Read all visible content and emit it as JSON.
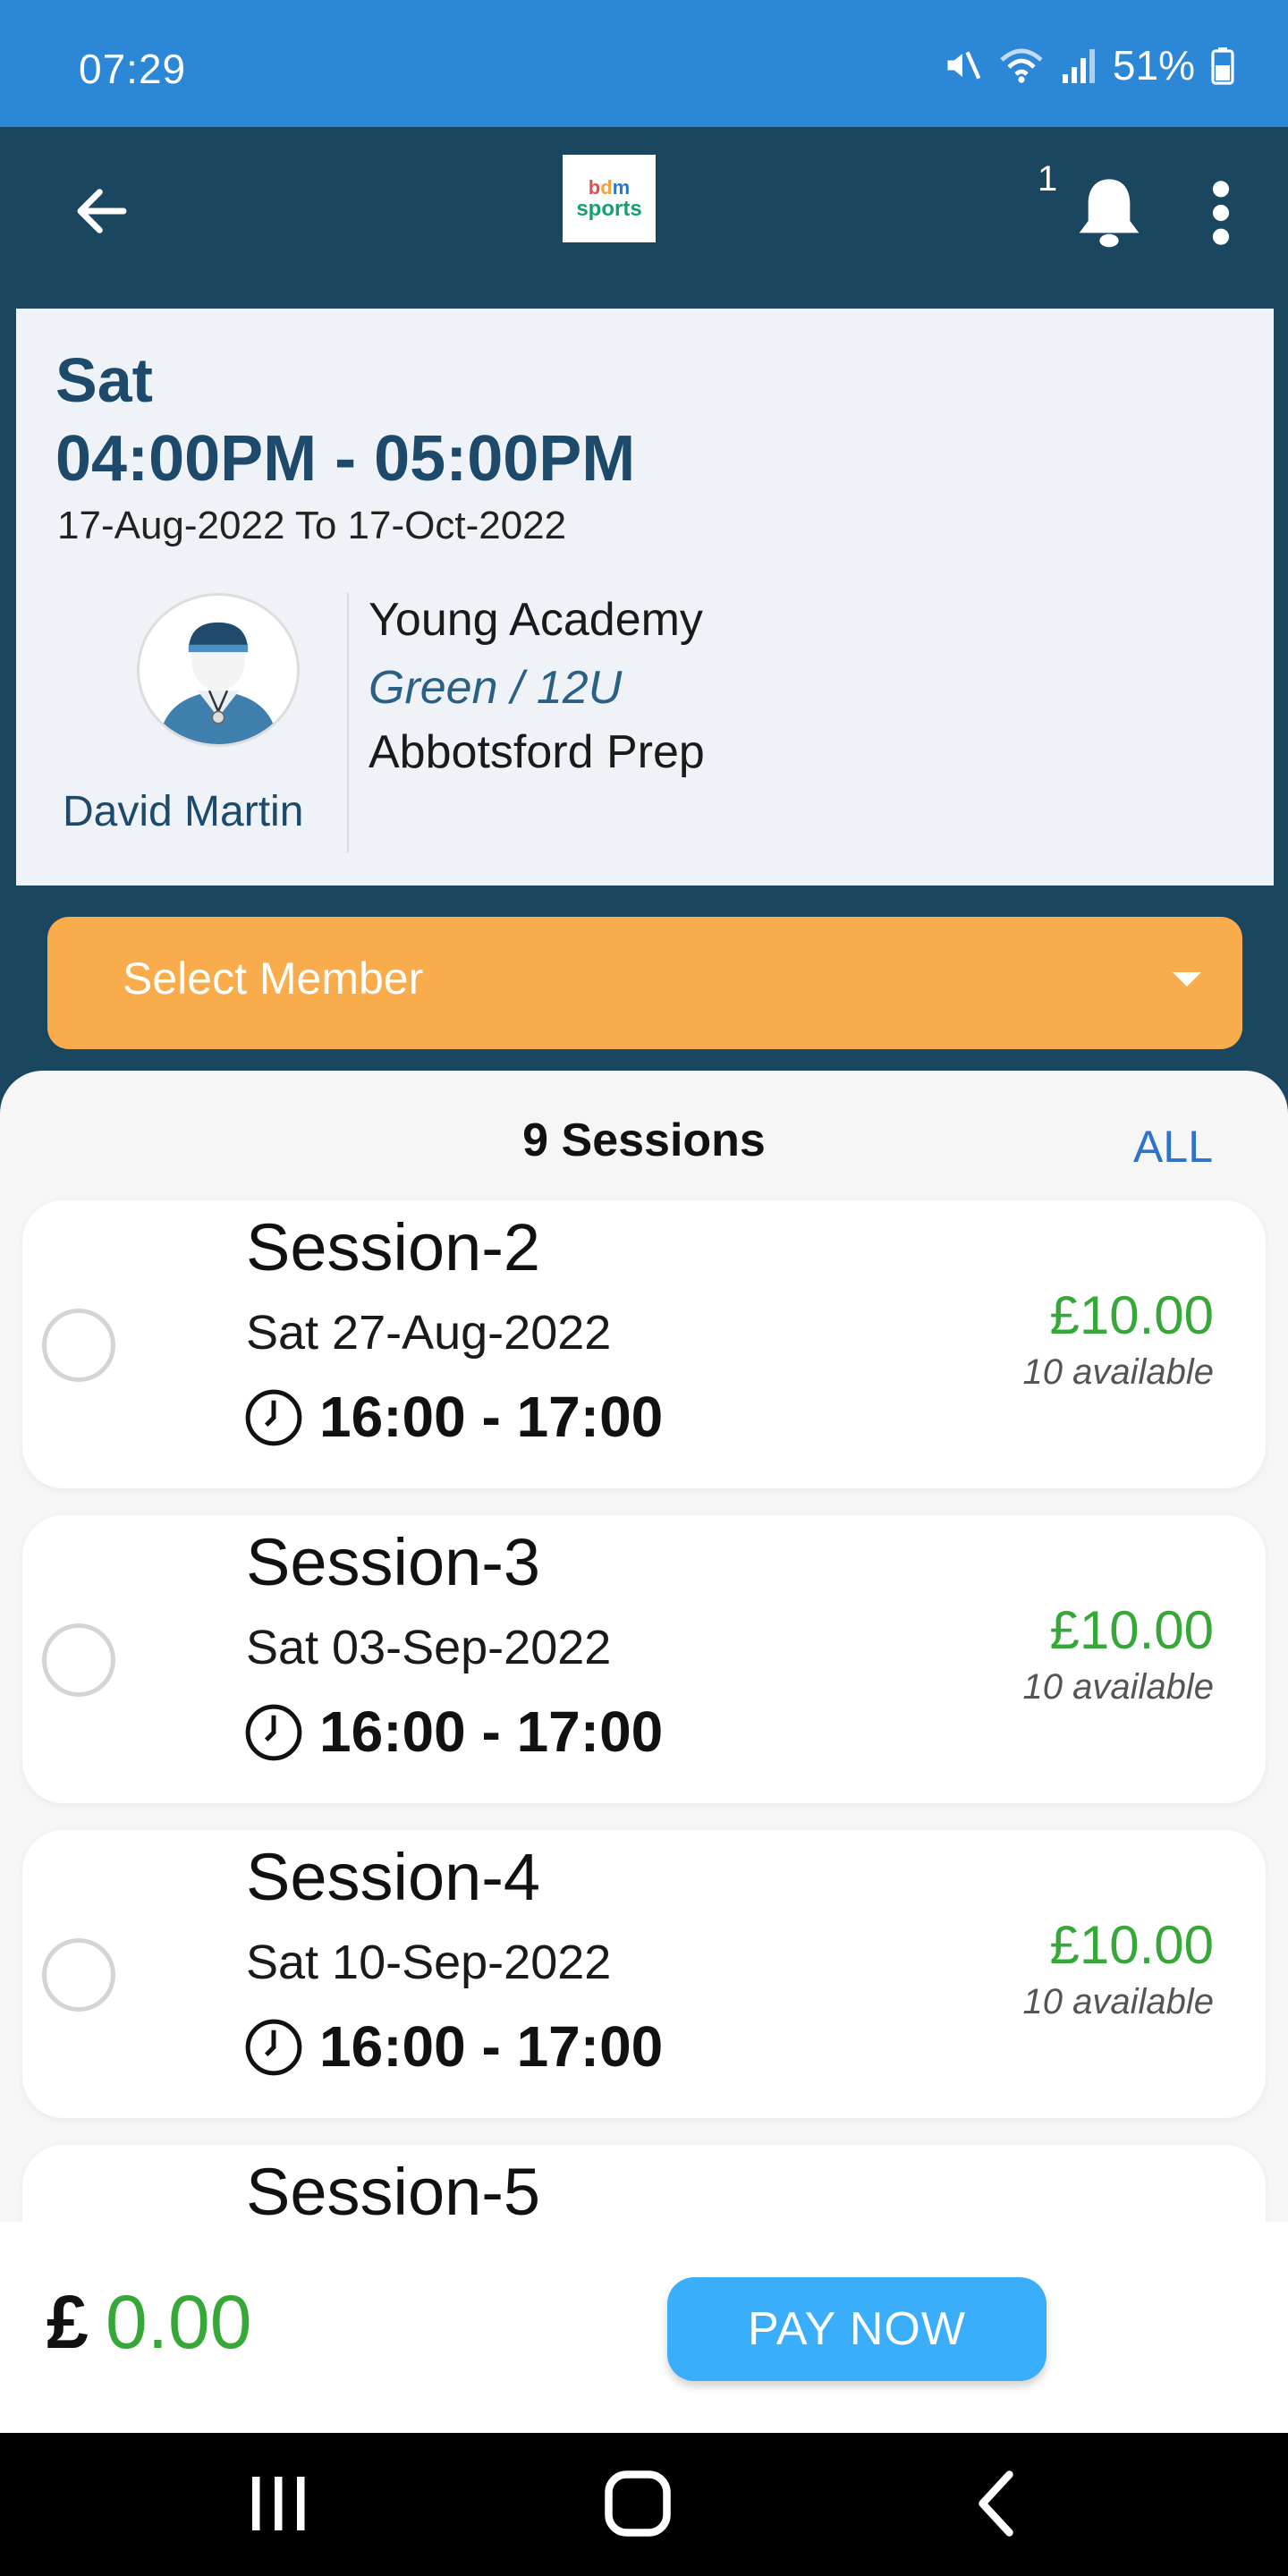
{
  "status_bar": {
    "time": "07:29",
    "battery": "51%",
    "icons": [
      "mute-icon",
      "wifi-icon",
      "signal-icon",
      "battery-icon"
    ]
  },
  "app_bar": {
    "logo_line1": "bdm",
    "logo_line2": "sports",
    "notification_count": "1"
  },
  "event": {
    "day": "Sat",
    "time": "04:00PM - 05:00PM",
    "date_range": "17-Aug-2022 To 17-Oct-2022",
    "coach_name": "David Martin",
    "club": "Young Academy",
    "team": "Green / 12U",
    "venue": "Abbotsford Prep"
  },
  "select_member": {
    "label": "Select Member"
  },
  "sessions": {
    "count_label": "9 Sessions",
    "all_label": "ALL",
    "items": [
      {
        "title": "Session-2",
        "date": "Sat 27-Aug-2022",
        "time": "16:00 - 17:00",
        "price": "£10.00",
        "available": "10 available"
      },
      {
        "title": "Session-3",
        "date": "Sat 03-Sep-2022",
        "time": "16:00 - 17:00",
        "price": "£10.00",
        "available": "10 available"
      },
      {
        "title": "Session-4",
        "date": "Sat 10-Sep-2022",
        "time": "16:00 - 17:00",
        "price": "£10.00",
        "available": "10 available"
      },
      {
        "title": "Session-5",
        "date": "",
        "time": "",
        "price": "",
        "available": ""
      }
    ]
  },
  "payment": {
    "currency": "£",
    "total": "0.00",
    "pay_label": "PAY NOW"
  },
  "colors": {
    "status_bar": "#2c87d7",
    "app_bar": "#1a4660",
    "accent_orange": "#f8ac4c",
    "price_green": "#36a837",
    "pay_button": "#3aaefa"
  }
}
